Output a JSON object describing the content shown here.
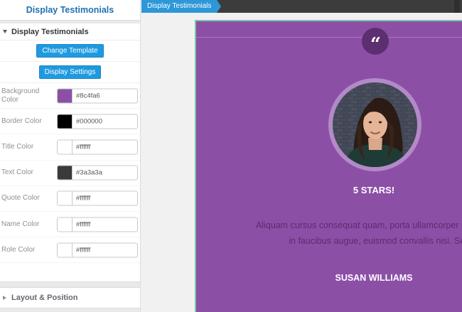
{
  "panel": {
    "title": "Display Testimonials",
    "section_open": "Display Testimonials",
    "change_template_label": "Change Template",
    "display_settings_label": "Display Settings",
    "colors": [
      {
        "label": "Background Color",
        "value": "#8c4fa6",
        "swatch": "#8c4fa6"
      },
      {
        "label": "Border Color",
        "value": "#000000",
        "swatch": "#000000"
      },
      {
        "label": "Title Color",
        "value": "#ffffff",
        "swatch": "#ffffff"
      },
      {
        "label": "Text Color",
        "value": "#3a3a3a",
        "swatch": "#3a3a3a"
      },
      {
        "label": "Quote Color",
        "value": "#ffffff",
        "swatch": "#ffffff"
      },
      {
        "label": "Name Color",
        "value": "#ffffff",
        "swatch": "#ffffff"
      },
      {
        "label": "Role Color",
        "value": "#ffffff",
        "swatch": "#ffffff"
      }
    ],
    "section_collapsed": "Layout & Position"
  },
  "breadcrumb": {
    "label": "Display Testimonials"
  },
  "preview": {
    "quote_icon": "quote-icon",
    "rating_title": "5 STARS!",
    "quote_line_1": "Aliquam cursus consequat quam, porta ullamcorper nibh vel",
    "quote_line_2": "in faucibus augue, euismod convallis nisi. Sed gravida",
    "name": "SUSAN WILLIAMS"
  },
  "theme": {
    "accent": "#1e9ae0",
    "card_background": "#8c4fa6",
    "header_text": "#2271b1"
  }
}
